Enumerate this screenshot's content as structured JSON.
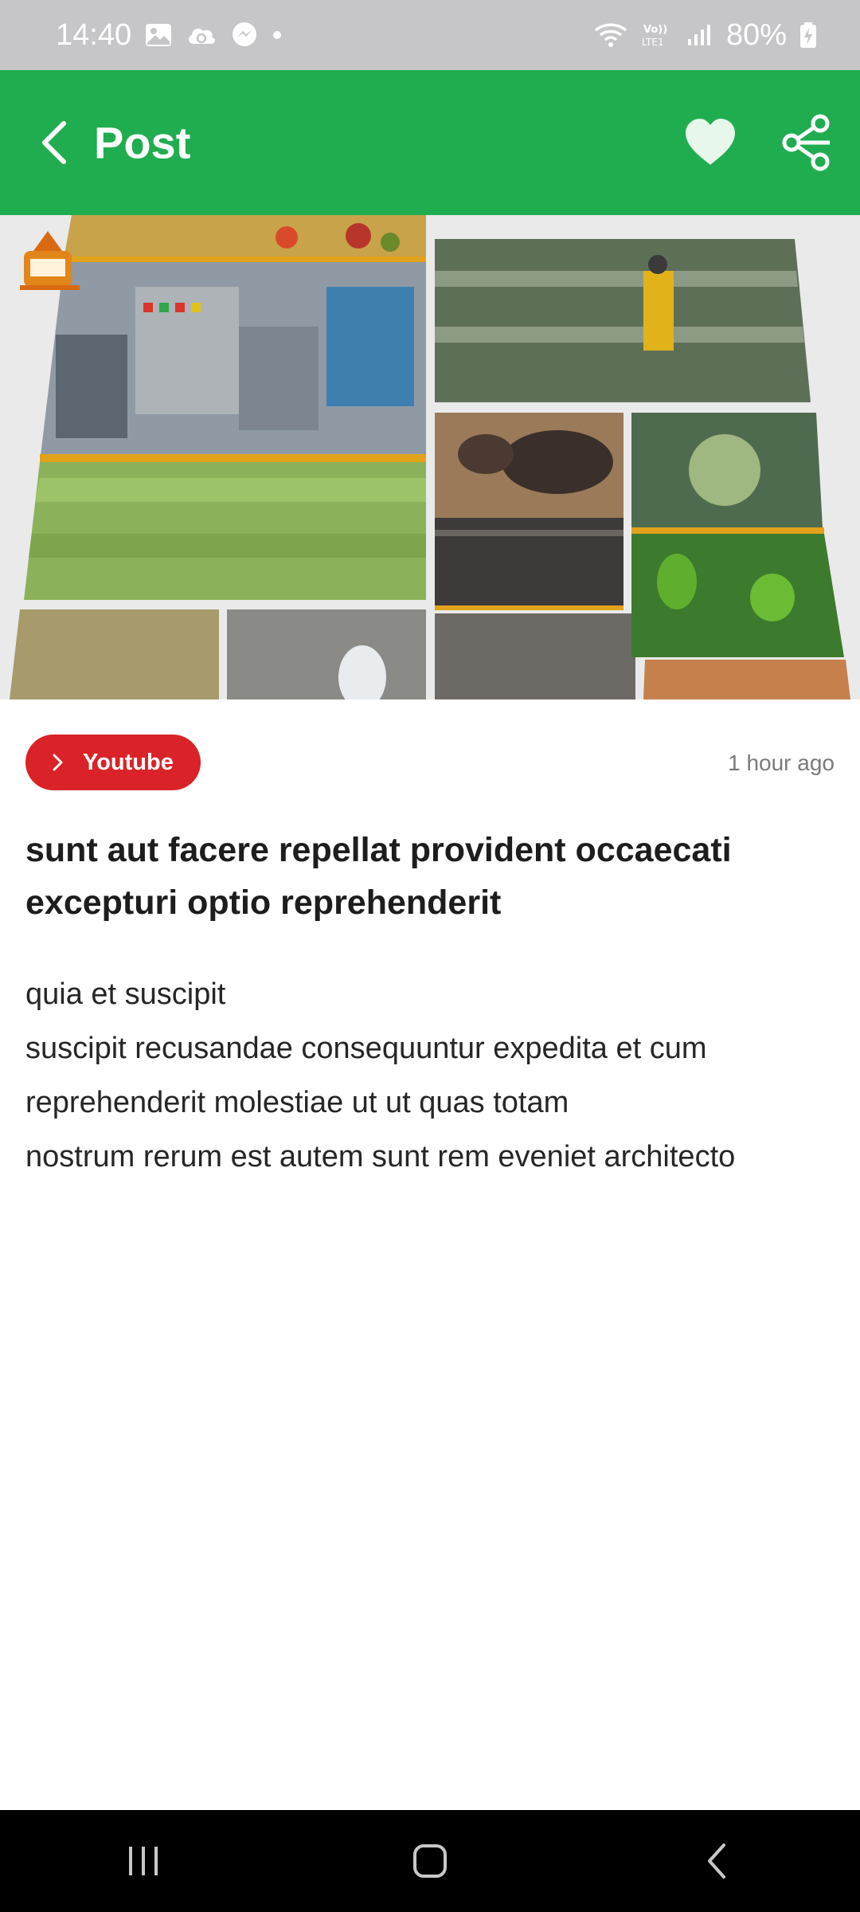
{
  "status_bar": {
    "time": "14:40",
    "battery": "80%",
    "icons": [
      "image-icon",
      "cloud-sync-icon",
      "messenger-icon",
      "dot-icon",
      "wifi-icon",
      "volte-icon",
      "signal-icon",
      "battery-charging-icon"
    ]
  },
  "app_bar": {
    "title": "Post",
    "back_icon": "chevron-left-icon",
    "favorite_icon": "heart-icon",
    "share_icon": "share-icon"
  },
  "post": {
    "source_label": "Youtube",
    "time_ago": "1 hour ago",
    "title": "sunt aut facere repellat provident occaecati excepturi optio reprehenderit",
    "body_lines": [
      "quia et suscipit",
      "suscipit recusandae consequuntur expedita et cum",
      "reprehenderit molestiae ut ut quas totam",
      "nostrum rerum est autem sunt rem eveniet architecto"
    ]
  },
  "colors": {
    "app_bar": "#20ad50",
    "source_chip": "#d92328",
    "status_bar": "#c6c6c8",
    "nav_bar": "#000000"
  },
  "nav_bar": {
    "icons": [
      "recent-apps-icon",
      "home-icon",
      "back-icon"
    ]
  }
}
